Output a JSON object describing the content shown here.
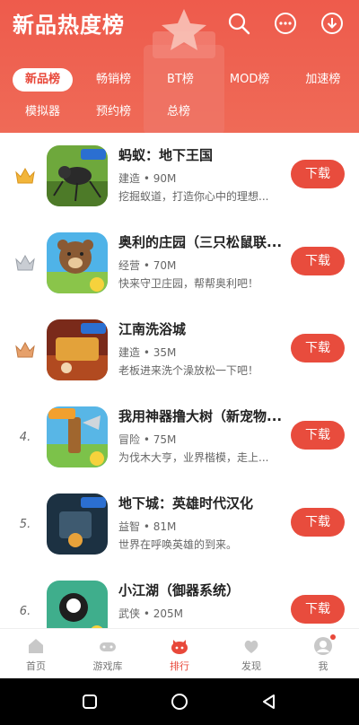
{
  "header": {
    "title": "新品热度榜",
    "icons": [
      "search-icon",
      "more-icon",
      "download-icon"
    ]
  },
  "tabs": {
    "row1": [
      "新品榜",
      "畅销榜",
      "BT榜",
      "MOD榜",
      "加速榜"
    ],
    "row2": [
      "模拟器",
      "预约榜",
      "总榜"
    ],
    "active": "新品榜"
  },
  "apps": [
    {
      "rank": "1",
      "rank_icon": "gold-crown-icon",
      "name": "蚂蚁：地下王国",
      "meta": "建造 • 90M",
      "desc": "挖掘蚁道，打造你心中的理想...",
      "button": "下载"
    },
    {
      "rank": "2",
      "rank_icon": "silver-crown-icon",
      "name": "奥利的庄园（三只松鼠联...",
      "meta": "经营 • 70M",
      "desc": "快来守卫庄园，帮帮奥利吧！",
      "button": "下载"
    },
    {
      "rank": "3",
      "rank_icon": "bronze-crown-icon",
      "name": "江南洗浴城",
      "meta": "建造 • 35M",
      "desc": "老板进来洗个澡放松一下吧！",
      "button": "下载"
    },
    {
      "rank": "4.",
      "name": "我用神器撸大树（新宠物...",
      "meta": "冒险 • 75M",
      "desc": "为伐木大亨，业界楷模，走上...",
      "button": "下载"
    },
    {
      "rank": "5.",
      "name": "地下城：英雄时代汉化",
      "meta": "益智 • 81M",
      "desc": "世界在呼唤英雄的到来。",
      "button": "下载"
    },
    {
      "rank": "6.",
      "name": "小江湖（御器系统）",
      "meta": "武侠 • 205M",
      "desc": "",
      "button": "下载"
    }
  ],
  "bottom_nav": [
    {
      "label": "首页",
      "icon": "home-icon"
    },
    {
      "label": "游戏库",
      "icon": "gamepad-icon"
    },
    {
      "label": "排行",
      "icon": "ranking-icon",
      "active": true
    },
    {
      "label": "发现",
      "icon": "discover-icon"
    },
    {
      "label": "我",
      "icon": "profile-icon"
    }
  ],
  "colors": {
    "accent": "#e84c3d",
    "header": "#ee5b4c"
  }
}
